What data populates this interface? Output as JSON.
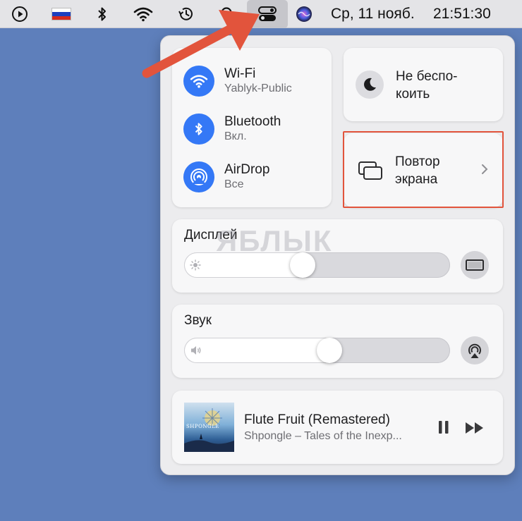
{
  "menubar": {
    "date": "Ср, 11 нояб.",
    "time": "21:51:30",
    "icons": [
      "play-circle-icon",
      "flag-russia-icon",
      "bluetooth-icon",
      "wifi-icon",
      "time-machine-icon",
      "search-icon",
      "control-center-icon",
      "siri-icon"
    ]
  },
  "connectivity": {
    "wifi": {
      "title": "Wi-Fi",
      "subtitle": "Yablyk-Public"
    },
    "bluetooth": {
      "title": "Bluetooth",
      "subtitle": "Вкл."
    },
    "airdrop": {
      "title": "AirDrop",
      "subtitle": "Все"
    }
  },
  "dnd": {
    "label_line1": "Не беспо-",
    "label_line2": "коить"
  },
  "screen_mirroring": {
    "label_line1": "Повтор",
    "label_line2": "экрана"
  },
  "display": {
    "label": "Дисплей",
    "brightness_percent": 44
  },
  "sound": {
    "label": "Звук",
    "volume_percent": 55
  },
  "now_playing": {
    "title": "Flute Fruit (Remastered)",
    "subtitle": "Shpongle – Tales of the Inexp...",
    "album_art_text": "SHPONGLE"
  },
  "watermark": "ЯБЛЫК",
  "colors": {
    "accent": "#3478f6",
    "annotation": "#e2543c",
    "desktop": "#5e7fbb"
  }
}
